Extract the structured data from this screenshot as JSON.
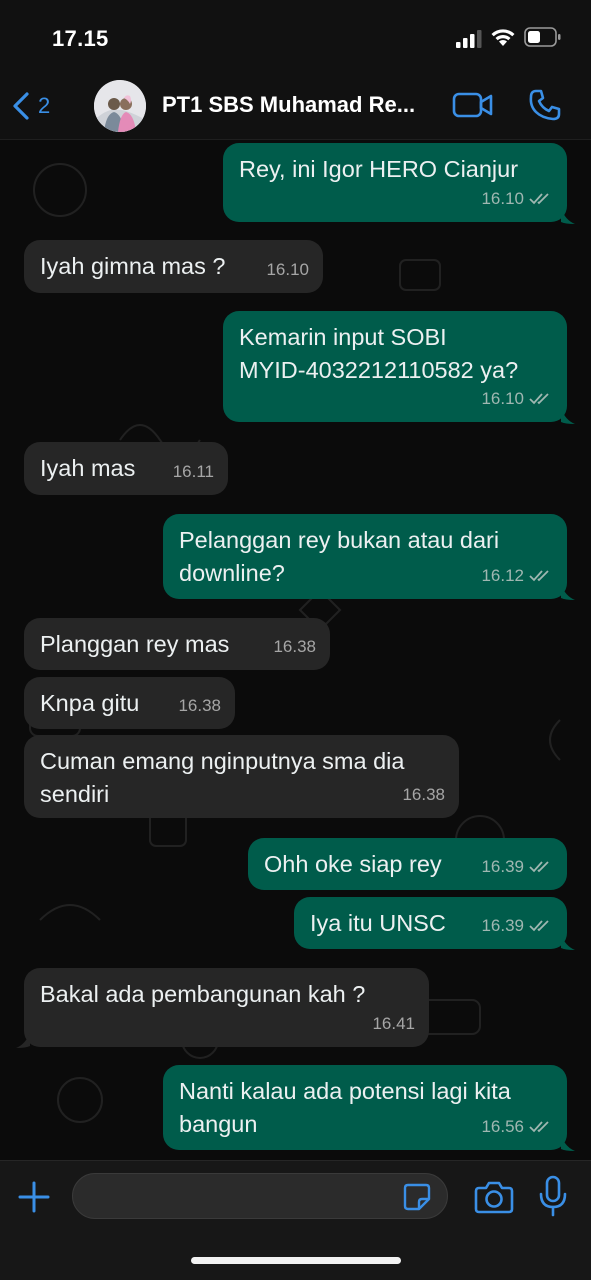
{
  "status_bar": {
    "time": "17.15"
  },
  "header": {
    "back_count": "2",
    "chat_title": "PT1 SBS Muhamad Re..."
  },
  "messages": [
    {
      "dir": "out",
      "text": "Rey, ini Igor HERO Cianjur",
      "time": "16.10",
      "ticks": "double-check-icon"
    },
    {
      "dir": "in",
      "text": "Iyah gimna mas ?",
      "time": "16.10"
    },
    {
      "dir": "out",
      "text": "Kemarin input SOBI\nMYID-4032212110582 ya?",
      "time": "16.10",
      "ticks": "double-check-icon"
    },
    {
      "dir": "in",
      "text": "Iyah mas",
      "time": "16.11"
    },
    {
      "dir": "out",
      "text": "Pelanggan rey bukan atau dari\ndownline?",
      "time": "16.12",
      "ticks": "double-check-icon"
    },
    {
      "dir": "in",
      "text": "Planggan rey mas",
      "time": "16.38"
    },
    {
      "dir": "in",
      "text": "Knpa gitu",
      "time": "16.38"
    },
    {
      "dir": "in",
      "text": "Cuman emang nginputnya sma dia\nsendiri",
      "time": "16.38"
    },
    {
      "dir": "out",
      "text": "Ohh oke siap rey",
      "time": "16.39",
      "ticks": "double-check-icon"
    },
    {
      "dir": "out",
      "text": "Iya itu UNSC",
      "time": "16.39",
      "ticks": "double-check-icon"
    },
    {
      "dir": "in",
      "text": "Bakal ada pembangunan kah ?",
      "time": "16.41"
    },
    {
      "dir": "out",
      "text": "Nanti kalau ada potensi lagi kita\nbangun",
      "time": "16.56",
      "ticks": "double-check-icon"
    }
  ],
  "input": {
    "value": "",
    "placeholder": ""
  },
  "colors": {
    "outgoing_bubble": "#005c4b",
    "incoming_bubble": "#262626",
    "accent": "#3a8fe6"
  }
}
